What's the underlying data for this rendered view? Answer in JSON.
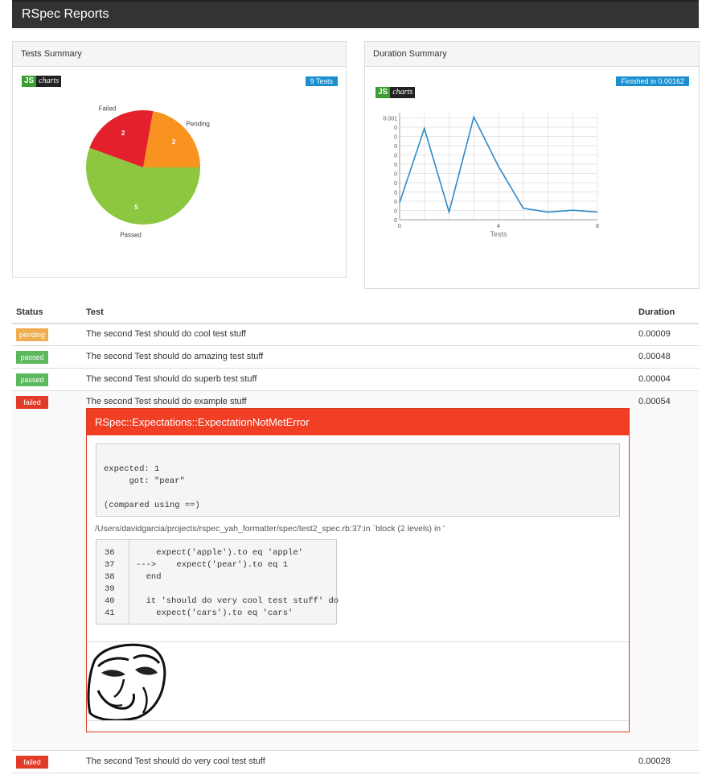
{
  "app": {
    "title": "RSpec Reports"
  },
  "tests_summary": {
    "title": "Tests Summary",
    "badge": "9 Tests",
    "logo_js": "JS",
    "logo_charts": "charts",
    "pie": {
      "type": "pie",
      "slices": [
        {
          "label": "Failed",
          "value": 2,
          "color": "#e3202c"
        },
        {
          "label": "Pending",
          "value": 2,
          "color": "#f7931e"
        },
        {
          "label": "Passed",
          "value": 5,
          "color": "#8dc63f"
        }
      ]
    }
  },
  "duration_summary": {
    "title": "Duration Summary",
    "badge": "Finished in 0.00162",
    "logo_js": "JS",
    "logo_charts": "charts"
  },
  "chart_data": {
    "type": "line",
    "x": [
      0,
      1,
      2,
      3,
      4,
      5,
      6,
      7,
      8
    ],
    "values": [
      9e-05,
      0.00048,
      4e-05,
      0.00054,
      0.00028,
      6e-05,
      4e-05,
      5e-05,
      4e-05
    ],
    "xlabel": "Tests",
    "x_ticks": [
      "0",
      "4",
      "8"
    ],
    "y_ticks": [
      "0",
      "0",
      "0",
      "0",
      "0",
      "0",
      "0",
      "0",
      "0",
      "0",
      "0",
      "0.001",
      "0.001"
    ],
    "line_color": "#2d8ac7",
    "grid": true
  },
  "table": {
    "headers": {
      "status": "Status",
      "test": "Test",
      "duration": "Duration"
    },
    "rows": [
      {
        "status": "pending",
        "name": "The second Test should do cool test stuff",
        "duration": "0.00009"
      },
      {
        "status": "passed",
        "name": "The second Test should do amazing test stuff",
        "duration": "0.00048"
      },
      {
        "status": "passed",
        "name": "The second Test should do superb test stuff",
        "duration": "0.00004"
      },
      {
        "status": "failed",
        "name": "The second Test should do example stuff",
        "duration": "0.00054"
      },
      {
        "status": "failed",
        "name": "The second Test should do very cool test stuff",
        "duration": "0.00028"
      }
    ]
  },
  "error": {
    "title": "RSpec::Expectations::ExpectationNotMetError",
    "message": "expected: 1\n     got: \"pear\"\n\n(compared using ==)",
    "path": "/Users/davidgarcia/projects/rspec_yah_formatter/spec/test2_spec.rb:37:in `block (2 levels) in '",
    "line_numbers": "36\n37\n38\n39\n40\n41",
    "code": "    expect('apple').to eq 'apple'\n--->    expect('pear').to eq 1\n  end\n\n  it 'should do very cool test stuff' do\n    expect('cars').to eq 'cars'"
  }
}
